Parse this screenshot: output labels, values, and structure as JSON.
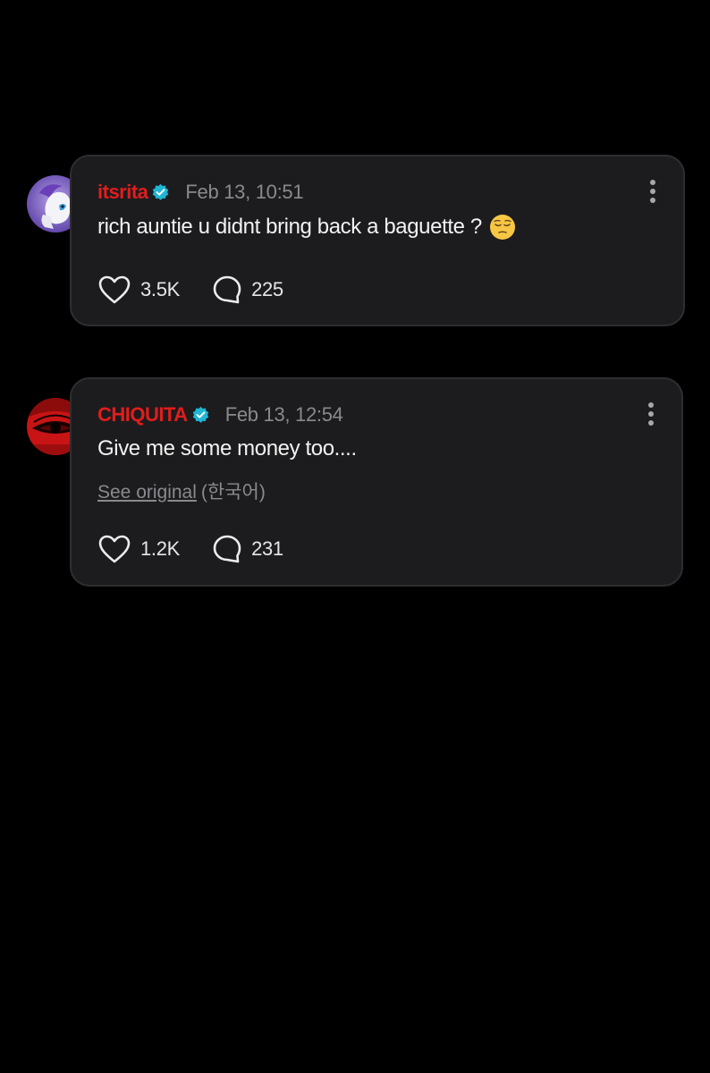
{
  "colors": {
    "background": "#000000",
    "card": "#1c1c1e",
    "card_border": "#2e2e30",
    "username": "#e11d1d",
    "verified_badge": "#1fb6d4",
    "muted_text": "#8a8a8e",
    "body_text": "#f2f2f2"
  },
  "comments": [
    {
      "username": "itsrita",
      "verified": true,
      "timestamp": "Feb 13, 10:51",
      "text": "rich auntie u didnt bring back a baguette ?",
      "emoji": "pensive-face-emoji",
      "likes": "3.5K",
      "replies": "225",
      "avatar_icon": "white-pony-avatar",
      "menu_icon": "more-options-icon"
    },
    {
      "username": "CHIQUITA",
      "verified": true,
      "timestamp": "Feb 13, 12:54",
      "text": "Give me some money too....",
      "see_original_label": "See original",
      "original_language": "(한국어)",
      "likes": "1.2K",
      "replies": "231",
      "avatar_icon": "red-eye-avatar",
      "menu_icon": "more-options-icon"
    }
  ],
  "icons": {
    "like": "heart-outline-icon",
    "reply": "speech-bubble-outline-icon",
    "verified": "verified-check-badge-icon"
  }
}
